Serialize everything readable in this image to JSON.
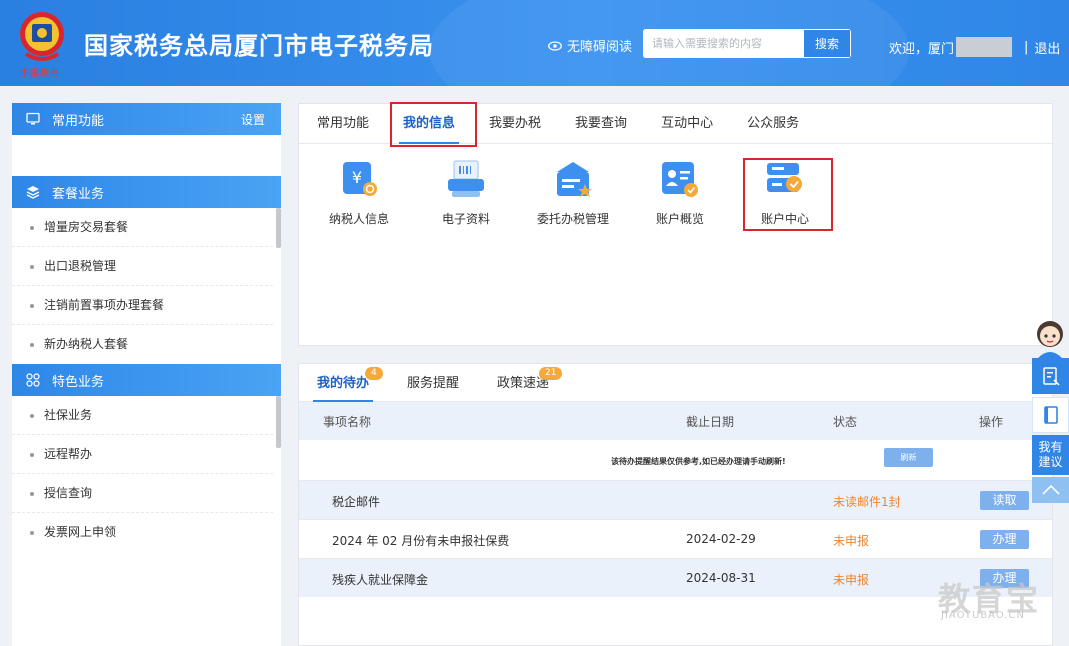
{
  "header": {
    "emblem_caption": "中国税务",
    "title": "国家税务总局厦门市电子税务局",
    "accessibility_label": "无障碍阅读",
    "search": {
      "placeholder": "请输入需要搜索的内容",
      "button_label": "搜索"
    },
    "welcome_label": "欢迎，厦门",
    "logout_label": "退出"
  },
  "sidebar": {
    "common": {
      "title": "常用功能",
      "settings_label": "设置"
    },
    "package": {
      "title": "套餐业务",
      "items": [
        "增量房交易套餐",
        "出口退税管理",
        "注销前置事项办理套餐",
        "新办纳税人套餐"
      ]
    },
    "special": {
      "title": "特色业务",
      "items": [
        "社保业务",
        "远程帮办",
        "授信查询",
        "发票网上申领"
      ]
    }
  },
  "main": {
    "tabs": [
      "常用功能",
      "我的信息",
      "我要办税",
      "我要查询",
      "互动中心",
      "公众服务"
    ],
    "active_tab": "我的信息",
    "functions": [
      {
        "label": "纳税人信息",
        "icon": "taxpayer-info-icon"
      },
      {
        "label": "电子资料",
        "icon": "e-documents-icon"
      },
      {
        "label": "委托办税管理",
        "icon": "entrusted-tax-icon"
      },
      {
        "label": "账户概览",
        "icon": "account-overview-icon"
      },
      {
        "label": "账户中心",
        "icon": "account-center-icon"
      }
    ]
  },
  "todo": {
    "tabs": [
      {
        "label": "我的待办",
        "badge": "4"
      },
      {
        "label": "服务提醒",
        "badge": ""
      },
      {
        "label": "政策速递",
        "badge": "21"
      }
    ],
    "columns": [
      "事项名称",
      "截止日期",
      "状态",
      "操作"
    ],
    "notice": "该待办提醒结果仅供参考,如已经办理请手动刷新!",
    "refresh_label": "刷新",
    "rows": [
      {
        "name": "税企邮件",
        "date": "",
        "status": "未读邮件1封",
        "action": "读取"
      },
      {
        "name": "2024 年 02 月份有未申报社保费",
        "date": "2024-02-29",
        "status": "未申报",
        "action": "办理"
      },
      {
        "name": "残疾人就业保障金",
        "date": "2024-08-31",
        "status": "未申报",
        "action": "办理"
      }
    ]
  },
  "floating": {
    "suggest_label_1": "我有",
    "suggest_label_2": "建议"
  },
  "watermark": {
    "main": "教育宝",
    "sub": "JIAOYUBAO.CN"
  },
  "colors": {
    "brand": "#2f86e6",
    "highlight": "#d9262c",
    "warning": "#f0852d"
  }
}
